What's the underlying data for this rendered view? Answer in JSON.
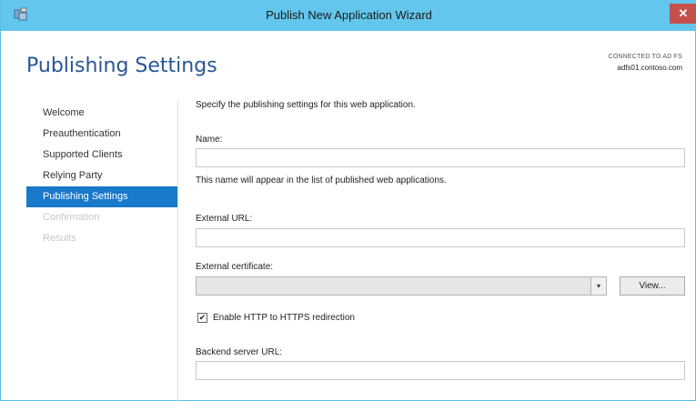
{
  "window": {
    "title": "Publish New Application Wizard",
    "close_glyph": "✕"
  },
  "header": {
    "title": "Publishing Settings",
    "connection_label": "CONNECTED TO AD FS",
    "connection_server": "adfs01.contoso.com"
  },
  "nav": {
    "items": [
      {
        "label": "Welcome",
        "state": "normal"
      },
      {
        "label": "Preauthentication",
        "state": "normal"
      },
      {
        "label": "Supported Clients",
        "state": "normal"
      },
      {
        "label": "Relying Party",
        "state": "normal"
      },
      {
        "label": "Publishing Settings",
        "state": "active"
      },
      {
        "label": "Confirmation",
        "state": "disabled"
      },
      {
        "label": "Results",
        "state": "disabled"
      }
    ]
  },
  "form": {
    "intro": "Specify the publishing settings for this web application.",
    "name_label": "Name:",
    "name_value": "",
    "name_hint": "This name will appear in the list of published web applications.",
    "external_url_label": "External URL:",
    "external_url_value": "",
    "external_certificate_label": "External certificate:",
    "external_certificate_value": "",
    "dropdown_glyph": "▾",
    "view_button": "View...",
    "redirect_checkbox_label": "Enable HTTP to HTTPS redirection",
    "redirect_checked": true,
    "check_glyph": "✔",
    "backend_url_label": "Backend server URL:",
    "backend_url_value": ""
  },
  "colors": {
    "accent": "#1979ca",
    "titlebar": "#63c6ec",
    "heading": "#2a5596",
    "close": "#c4504c"
  }
}
